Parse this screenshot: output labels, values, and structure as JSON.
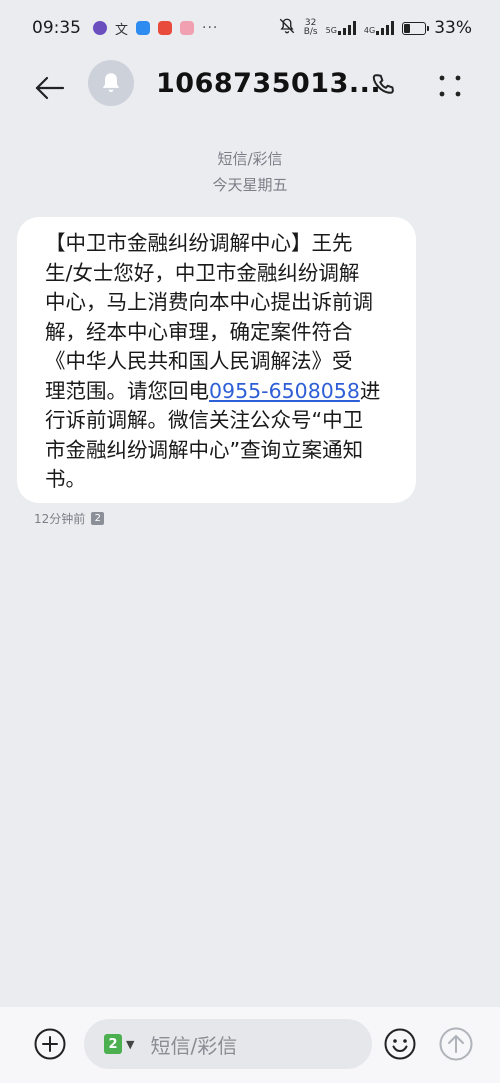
{
  "status_bar": {
    "time": "09:35",
    "net_speed_value": "32",
    "net_speed_unit": "B/s",
    "sim1_label": "5G",
    "sim2_label": "4G",
    "battery_percent": "33%",
    "battery_level": 0.33,
    "more_notifications": "···"
  },
  "header": {
    "title": "1068735013..."
  },
  "thread": {
    "type_label": "短信/彩信",
    "date_label": "今天星期五"
  },
  "message": {
    "lines": [
      "【中卫市金融纠纷调解中心】王先",
      "生/女士您好，中卫市金融纠纷调解",
      "中心，马上消费向本中心提出诉前调",
      "解，经本中心审理，确定案件符合",
      "《中华人民共和国人民调解法》受"
    ],
    "line6_prefix": "理范围。请您回电",
    "phone": "0955-6508058",
    "line6_suffix": "进",
    "line7": "行诉前调解。微信关注公众号“中卫",
    "line8": "市金融纠纷调解中心”查询立案通知",
    "line9": "书。"
  },
  "meta": {
    "time_ago": "12分钟前",
    "sim_slot": "2"
  },
  "composer": {
    "sim_selected": "2",
    "placeholder": "短信/彩信"
  },
  "colors": {
    "background": "#ebecf0",
    "bubble": "#ffffff",
    "link": "#2f5fd6",
    "sim_green": "#4caf50"
  }
}
